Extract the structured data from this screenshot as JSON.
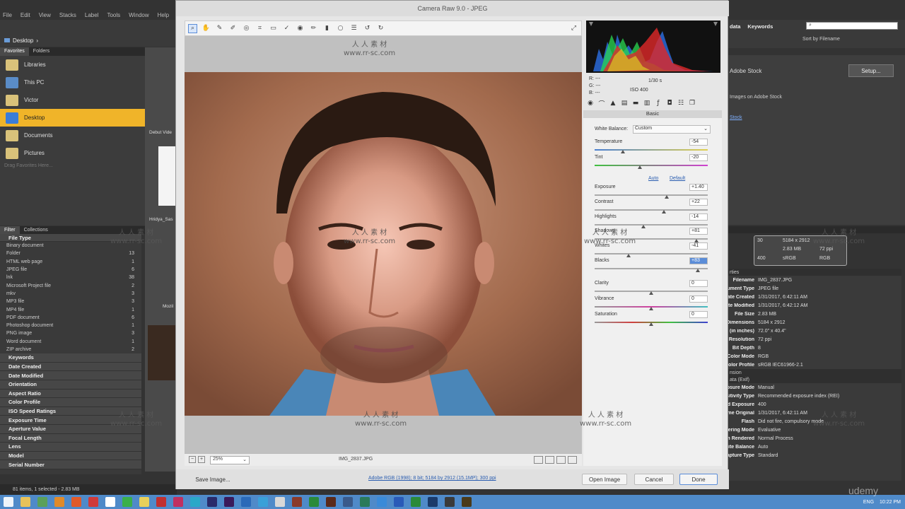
{
  "bridge": {
    "menu": [
      "File",
      "Edit",
      "View",
      "Stacks",
      "Label",
      "Tools",
      "Window",
      "Help"
    ],
    "path": "Desktop",
    "panel_tabs": [
      "Favorites",
      "Folders"
    ],
    "favorites": [
      "Libraries",
      "This PC",
      "Victor",
      "Desktop",
      "Documents",
      "Pictures"
    ],
    "favorites_hint": "Drag Favorites Here...",
    "filter_tabs": [
      "Filter",
      "Collections"
    ],
    "filter_header": "File Type",
    "file_types": [
      {
        "name": "Binary document",
        "count": ""
      },
      {
        "name": "Folder",
        "count": "13"
      },
      {
        "name": "HTML web page",
        "count": "1"
      },
      {
        "name": "JPEG file",
        "count": "6"
      },
      {
        "name": "lnk",
        "count": "38"
      },
      {
        "name": "Microsoft Project file",
        "count": "2"
      },
      {
        "name": "mkv",
        "count": "3"
      },
      {
        "name": "MP3 file",
        "count": "3"
      },
      {
        "name": "MP4 file",
        "count": "1"
      },
      {
        "name": "PDF document",
        "count": "6"
      },
      {
        "name": "Photoshop document",
        "count": "1"
      },
      {
        "name": "PNG image",
        "count": "3"
      },
      {
        "name": "Word document",
        "count": "1"
      },
      {
        "name": "ZIP archive",
        "count": "2"
      }
    ],
    "filter_sections": [
      "Keywords",
      "Date Created",
      "Date Modified",
      "Orientation",
      "Aspect Ratio",
      "Color Profile",
      "ISO Speed Ratings",
      "Exposure Time",
      "Aperture Value",
      "Focal Length",
      "Lens",
      "Model",
      "Serial Number"
    ],
    "status": "81 items, 1 selected - 2.83 MB",
    "content_labels": [
      "Debut Vide",
      "Hridya_Sas",
      "Mozil"
    ],
    "right_tabs": [
      "Metadata",
      "Keywords"
    ],
    "right_tab_visible": [
      "data",
      "Keywords"
    ],
    "sort_label": "Sort by Filename",
    "stock_title": "Adobe Stock",
    "setup_label": "Setup...",
    "stock_sub": "Images on Adobe Stock",
    "stock_link": "Stock",
    "meta_card": {
      "dims": "5184 x 2912",
      "size": "2.83 MB",
      "ppi": "72 ppi",
      "space": "sRGB",
      "mode": "RGB",
      "f": "30",
      "iso": "400"
    },
    "meta_sec1": "rties",
    "file_props": [
      {
        "k": "Filename",
        "v": "IMG_2837.JPG"
      },
      {
        "k": "Document Type",
        "v": "JPEG file"
      },
      {
        "k": "Date Created",
        "v": "1/31/2017, 6:42:11 AM"
      },
      {
        "k": "Date Modified",
        "v": "1/31/2017, 6:42:12 AM"
      },
      {
        "k": "File Size",
        "v": "2.83 MB"
      },
      {
        "k": "Dimensions",
        "v": "5184 x 2912"
      },
      {
        "k": "Dimensions (in inches)",
        "v": "72.0\" x 40.4\""
      },
      {
        "k": "Resolution",
        "v": "72 ppi"
      },
      {
        "k": "Bit Depth",
        "v": "8"
      },
      {
        "k": "Color Mode",
        "v": "RGB"
      },
      {
        "k": "Color Profile",
        "v": "sRGB IEC61966-2.1"
      }
    ],
    "meta_sec2": "nsion",
    "meta_sec3": "ata (Exif)",
    "exif": [
      {
        "k": "Exposure Mode",
        "v": "Manual"
      },
      {
        "k": "Sensitivity Type",
        "v": "Recommended exposure index (REI)"
      },
      {
        "k": "Recommended Exposure",
        "v": "400"
      },
      {
        "k": "Date Time Original",
        "v": "1/31/2017, 6:42:11 AM"
      },
      {
        "k": "Flash",
        "v": "Did not fire, compulsory mode"
      },
      {
        "k": "Metering Mode",
        "v": "Evaluative"
      },
      {
        "k": "Custom Rendered",
        "v": "Normal Process"
      },
      {
        "k": "White Balance",
        "v": "Auto"
      },
      {
        "k": "Capture Type",
        "v": "Standard"
      }
    ]
  },
  "camera_raw": {
    "title": "Camera Raw 9.0  -  JPEG",
    "zoom": "25%",
    "filename": "IMG_2837.JPG",
    "workflow": "Adobe RGB (1998); 8 bit; 5184 by 2912 (15.1MP); 300 ppi",
    "buttons": {
      "save": "Save Image...",
      "open": "Open Image",
      "cancel": "Cancel",
      "done": "Done"
    },
    "readout": {
      "r": "R:   ---",
      "g": "G:   ---",
      "b": "B:   ---",
      "shutter": "1/30 s",
      "iso": "ISO 400"
    },
    "panel_title": "Basic",
    "white_balance_label": "White Balance:",
    "white_balance_value": "Custom",
    "auto_label": "Auto",
    "default_label": "Default",
    "sliders": [
      {
        "label": "Temperature",
        "value": "-54",
        "pos": 0.25,
        "grad": "linear-gradient(90deg,#4a7fd0,#e0d050)"
      },
      {
        "label": "Tint",
        "value": "-20",
        "pos": 0.4,
        "grad": "linear-gradient(90deg,#40c040,#d040d0)"
      },
      {
        "label": "Exposure",
        "value": "+1.40",
        "pos": 0.64,
        "grad": ""
      },
      {
        "label": "Contrast",
        "value": "+22",
        "pos": 0.61,
        "grad": ""
      },
      {
        "label": "Highlights",
        "value": "-14",
        "pos": 0.43,
        "grad": ""
      },
      {
        "label": "Shadows",
        "value": "+81",
        "pos": 0.9,
        "grad": ""
      },
      {
        "label": "Whites",
        "value": "-41",
        "pos": 0.3,
        "grad": ""
      },
      {
        "label": "Blacks",
        "value": "+83",
        "pos": 0.91,
        "grad": ""
      },
      {
        "label": "Clarity",
        "value": "0",
        "pos": 0.5,
        "grad": ""
      },
      {
        "label": "Vibrance",
        "value": "0",
        "pos": 0.5,
        "grad": "linear-gradient(90deg,#999,#d040a0,#40c0c0)"
      },
      {
        "label": "Saturation",
        "value": "0",
        "pos": 0.5,
        "grad": "linear-gradient(90deg,#999,#d04040,#40c040,#4040d0)"
      }
    ]
  },
  "taskbar": {
    "lang": "ENG",
    "time": "10:22 PM"
  },
  "watermark": {
    "cn": "人 人 素 材",
    "url": "www.rr-sc.com"
  },
  "udemy": "udemy"
}
